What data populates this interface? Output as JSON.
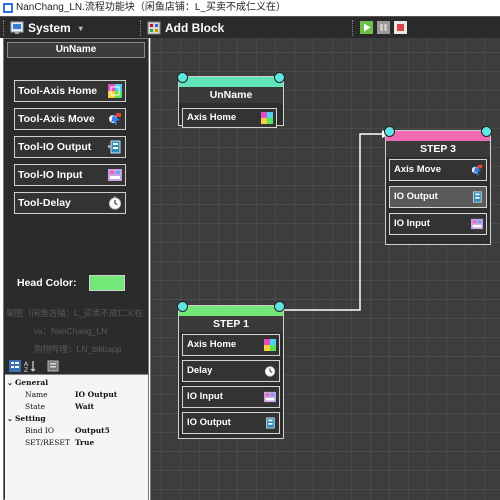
{
  "window": {
    "title": "NanChang_LN.流程功能块（闲鱼店铺：L_买卖不成仁义在）"
  },
  "toolbar": {
    "system_label": "System",
    "system_arrow": "▾",
    "add_block_label": "Add Block"
  },
  "left_panel": {
    "header": "UnName",
    "tools": [
      {
        "label": "Tool-Axis Home",
        "icon": "axis-home-icon"
      },
      {
        "label": "Tool-Axis Move",
        "icon": "axis-move-icon"
      },
      {
        "label": "Tool-IO Output",
        "icon": "io-output-icon"
      },
      {
        "label": "Tool-IO Input",
        "icon": "io-input-icon"
      },
      {
        "label": "Tool-Delay",
        "icon": "delay-icon"
      }
    ],
    "head_color_label": "Head Color:",
    "head_color": "#73e879",
    "watermark": {
      "line1": "架图（闲鱼店铺：L_买卖不成仁义在",
      "line2": "vx：NanChang_LN",
      "line3": "购物哔哩：LN_bilibapp"
    }
  },
  "properties": {
    "categories": [
      {
        "name": "General",
        "rows": [
          {
            "key": "Name",
            "value": "IO Output"
          },
          {
            "key": "State",
            "value": "Wait"
          }
        ]
      },
      {
        "name": "Setting",
        "rows": [
          {
            "key": "Bind IO",
            "value": "Output5"
          },
          {
            "key": "SET/RESET",
            "value": "True"
          }
        ]
      }
    ]
  },
  "canvas": {
    "blocks": [
      {
        "title": "UnName",
        "head_color": "#60e3b6",
        "items": [
          "Axis Home"
        ]
      },
      {
        "title": "STEP 3",
        "head_color": "#f06bb4",
        "items": [
          "Axis Move",
          "IO Output",
          "IO Input"
        ]
      },
      {
        "title": "STEP 1",
        "head_color": "#73e879",
        "items": [
          "Axis Home",
          "Delay",
          "IO Input",
          "IO Output"
        ]
      }
    ]
  },
  "colors": {
    "canvas_bg": "#3d3d3d",
    "panel_bg": "#2b2b2b",
    "toolbar_bg": "#2a2a2a",
    "port": "#5fe6e0",
    "wire": "#ffffff"
  }
}
